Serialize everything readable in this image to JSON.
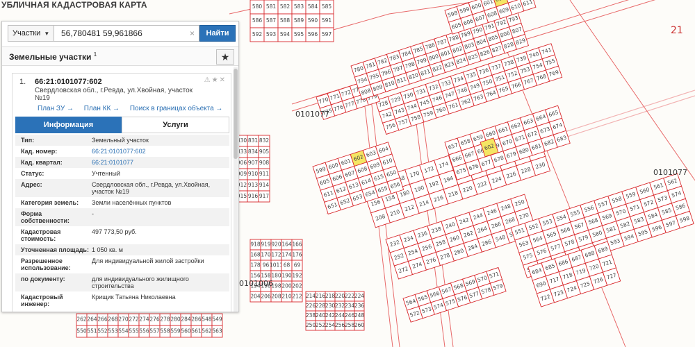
{
  "page_title": "УБЛИЧНАЯ КАДАСТРОВАЯ КАРТА",
  "colors": {
    "plot_border": "#d8292c",
    "selected_plot": "#f4e664",
    "accent": "#2b72b8"
  },
  "search": {
    "type_label": "Участки",
    "value": "56,780481 59,961866",
    "clear_icon": "close-icon",
    "button_label": "Найти"
  },
  "section": {
    "title": "Земельные участки",
    "count_sup": "1",
    "star_icon": "star-icon"
  },
  "result": {
    "number": "1.",
    "cadastral_id": "66:21:0101077:602",
    "address": "Свердловская обл., г.Ревда, ул.Хвойная, участок №19",
    "links": [
      "План ЗУ →",
      "План КК →",
      "Поиск в границах объекта →"
    ],
    "tabs": [
      "Информация",
      "Услуги"
    ],
    "attributes": [
      {
        "key": "Тип:",
        "value": "Земельный участок"
      },
      {
        "key": "Кад. номер:",
        "value": "66:21:0101077:602",
        "link": true
      },
      {
        "key": "Кад. квартал:",
        "value": "66:21:0101077",
        "link": true
      },
      {
        "key": "Статус:",
        "value": "Учтенный"
      },
      {
        "key": "Адрес:",
        "value": "Свердловская обл., г.Ревда, ул.Хвойная, участок №19"
      },
      {
        "key": "Категория земель:",
        "value": "Земли населённых пунктов"
      },
      {
        "key": "Форма собственности:",
        "value": "-"
      },
      {
        "key": "Кадастровая стоимость:",
        "value": "497 773,50 руб."
      },
      {
        "key": "Уточненная площадь:",
        "value": "1 050 кв. м"
      },
      {
        "key": "Разрешенное использование:",
        "value": "Для индивидуальной жилой застройки"
      },
      {
        "key": "по документу:",
        "value": "для индивидуального жилищного строительства"
      },
      {
        "key": "Кадастровый инженер:",
        "value": "Крищик Татьяна Николаевна"
      }
    ]
  },
  "map": {
    "quarter_labels": [
      "0101077",
      "0101077",
      "0101006",
      "21"
    ],
    "selected_plot": "602",
    "plots": [
      "164",
      "166",
      "168",
      "170",
      "172",
      "174",
      "176",
      "178",
      "96",
      "1011",
      "68",
      "69",
      "156",
      "158",
      "180",
      "190",
      "192",
      "194",
      "196",
      "198",
      "200",
      "202",
      "204",
      "206",
      "208",
      "210",
      "212",
      "214",
      "216",
      "218",
      "220",
      "222",
      "224",
      "226",
      "228",
      "230",
      "232",
      "234",
      "236",
      "238",
      "240",
      "242",
      "244",
      "246",
      "248",
      "250",
      "252",
      "254",
      "256",
      "258",
      "260",
      "262",
      "264",
      "266",
      "268",
      "270",
      "272",
      "274",
      "276",
      "278",
      "280",
      "284",
      "286",
      "548",
      "549",
      "550",
      "551",
      "552",
      "553",
      "554",
      "555",
      "556",
      "557",
      "558",
      "559",
      "560",
      "561",
      "562",
      "563",
      "564",
      "565",
      "566",
      "567",
      "568",
      "569",
      "570",
      "571",
      "572",
      "573",
      "574",
      "575",
      "576",
      "577",
      "578",
      "579",
      "580",
      "581",
      "582",
      "583",
      "584",
      "585",
      "586",
      "587",
      "588",
      "589",
      "590",
      "591",
      "592",
      "593",
      "594",
      "595",
      "596",
      "597",
      "598",
      "599",
      "600",
      "601",
      "602",
      "603",
      "604",
      "605",
      "606",
      "607",
      "608",
      "609",
      "610",
      "611",
      "612",
      "613",
      "614",
      "615",
      "650",
      "651",
      "652",
      "653",
      "654",
      "655",
      "656",
      "657",
      "658",
      "659",
      "660",
      "661",
      "662",
      "663",
      "664",
      "665",
      "666",
      "667",
      "668",
      "669",
      "670",
      "671",
      "672",
      "673",
      "674",
      "675",
      "676",
      "677",
      "678",
      "679",
      "680",
      "681",
      "682",
      "683",
      "684",
      "685",
      "686",
      "687",
      "688",
      "689",
      "690",
      "717",
      "718",
      "719",
      "720",
      "721",
      "722",
      "723",
      "724",
      "725",
      "726",
      "727",
      "728",
      "729",
      "730",
      "731",
      "732",
      "733",
      "734",
      "735",
      "736",
      "737",
      "738",
      "739",
      "740",
      "741",
      "742",
      "743",
      "744",
      "745",
      "746",
      "747",
      "748",
      "749",
      "750",
      "751",
      "752",
      "753",
      "754",
      "755",
      "756",
      "757",
      "758",
      "759",
      "760",
      "761",
      "762",
      "763",
      "764",
      "765",
      "766",
      "767",
      "768",
      "769",
      "770",
      "771",
      "772",
      "773",
      "774",
      "775",
      "776",
      "777",
      "778",
      "779",
      "780",
      "781",
      "782",
      "783",
      "784",
      "785",
      "786",
      "787",
      "788",
      "789",
      "790",
      "791",
      "792",
      "793",
      "794",
      "795",
      "796",
      "797",
      "798",
      "799",
      "800",
      "801",
      "802",
      "803",
      "804",
      "805",
      "806",
      "807",
      "808",
      "809",
      "810",
      "811",
      "820",
      "821",
      "822",
      "823",
      "824",
      "825",
      "826",
      "827",
      "828",
      "829",
      "830",
      "831",
      "832",
      "833",
      "834",
      "905",
      "906",
      "907",
      "908",
      "909",
      "910",
      "911",
      "912",
      "913",
      "914",
      "915",
      "916",
      "917",
      "918",
      "919",
      "920"
    ]
  }
}
